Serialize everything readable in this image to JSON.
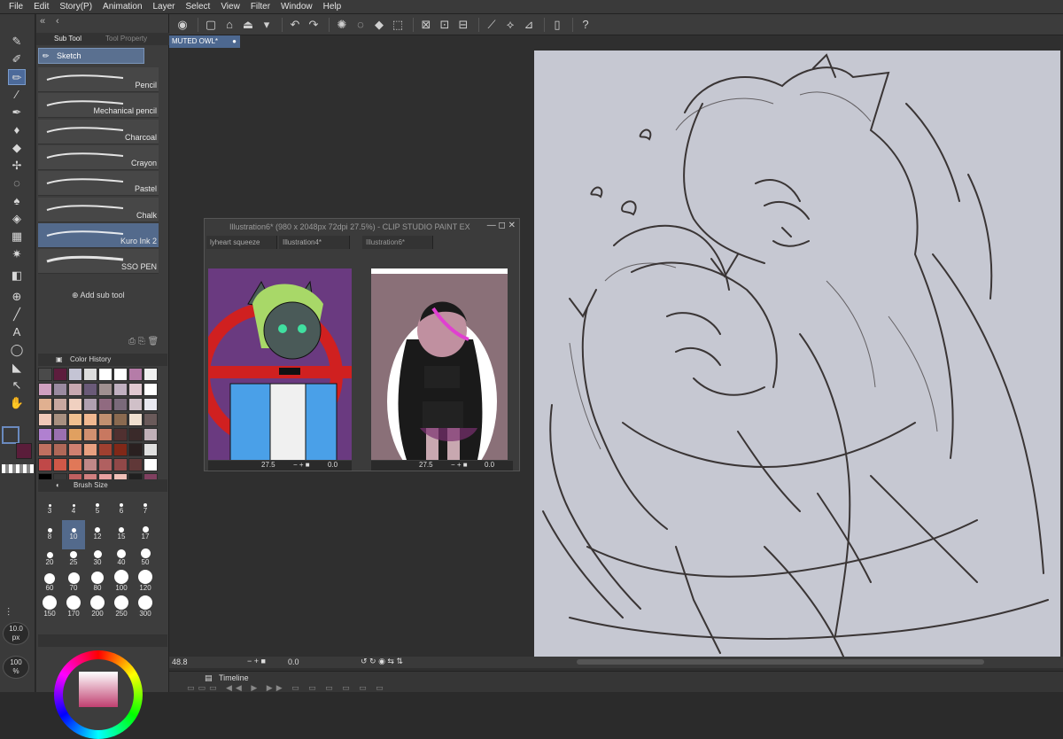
{
  "menu": [
    "File",
    "Edit",
    "Story(P)",
    "Animation",
    "Layer",
    "Select",
    "View",
    "Filter",
    "Window",
    "Help"
  ],
  "subtool": {
    "tabs": [
      "Sub Tool",
      "Tool Property"
    ],
    "group": "Sketch",
    "brushes": [
      "Pencil",
      "Mechanical pencil",
      "Charcoal",
      "Crayon",
      "Pastel",
      "Chalk",
      "Kuro Ink 2",
      "SSO PEN"
    ],
    "selected_index": 6,
    "add_label": "Add sub tool"
  },
  "color_history": {
    "title": "Color History",
    "swatches": [
      "#4a4a4a",
      "#5d1d3d",
      "#c4c4d4",
      "#dcdcdc",
      "#ffffff",
      "#ffffff",
      "#b57ca8",
      "#f0f0f0",
      "#d0a0c0",
      "#9a8aa0",
      "#c8a8b0",
      "#6a5a78",
      "#a09090",
      "#c0b0c0",
      "#e0c8d0",
      "#ffffff",
      "#e0b090",
      "#c8a8a0",
      "#f0d0c0",
      "#b0a0b0",
      "#906a80",
      "#7a6a7a",
      "#d0c0c8",
      "#e8e8f0",
      "#f0c8b8",
      "#a89080",
      "#f0c090",
      "#f0b890",
      "#c09070",
      "#8a6a50",
      "#f0e0d0",
      "#6a5a5a",
      "#b080d0",
      "#9a70b0",
      "#e0a060",
      "#d09070",
      "#c87860",
      "#503030",
      "#3a2a2a",
      "#c0b0b8",
      "#c07060",
      "#b06858",
      "#d08070",
      "#e8a080",
      "#a04030",
      "#802818",
      "#2a2020",
      "#e0e0e0",
      "#c04848",
      "#d05848",
      "#e07858",
      "#c08888",
      "#b06060",
      "#904848",
      "#603838",
      "#ffffff",
      "#000000",
      "#3a3a3a",
      "#c06060",
      "#d08080",
      "#e8a0a0",
      "#f0c0b8",
      "#202020",
      "#804060"
    ],
    "main_color": "#ffffff",
    "sub_color": "#5a1d3a"
  },
  "brush_size": {
    "title": "Brush Size",
    "sizes": [
      "3",
      "4",
      "5",
      "6",
      "7",
      "8",
      "10",
      "12",
      "15",
      "17",
      "20",
      "25",
      "30",
      "40",
      "50",
      "60",
      "70",
      "80",
      "100",
      "120",
      "150",
      "170",
      "200",
      "250",
      "300"
    ],
    "selected": "10"
  },
  "brush_readout": {
    "size": "10.0",
    "unit": "px",
    "opacity": "100",
    "opacity_unit": "%"
  },
  "doc_tab": "MUTED OWL*",
  "subwindow": {
    "title": "Illustration6* (980 x 2048px 72dpi 27.5%) - CLIP STUDIO PAINT EX",
    "left_tabs": [
      "lyheart squeeze",
      "Illustration4*"
    ],
    "right_tab": "Illustration6*",
    "left_zoom": "27.5",
    "left_angle": "0.0",
    "right_zoom": "27.5",
    "right_angle": "0.0"
  },
  "status": {
    "zoom": "48.8",
    "angle": "0.0"
  },
  "timeline": {
    "label": "Timeline"
  },
  "colors": {
    "accent": "#536a8c",
    "canvas": "#c6c8d2",
    "sketch": "#3a3535"
  }
}
